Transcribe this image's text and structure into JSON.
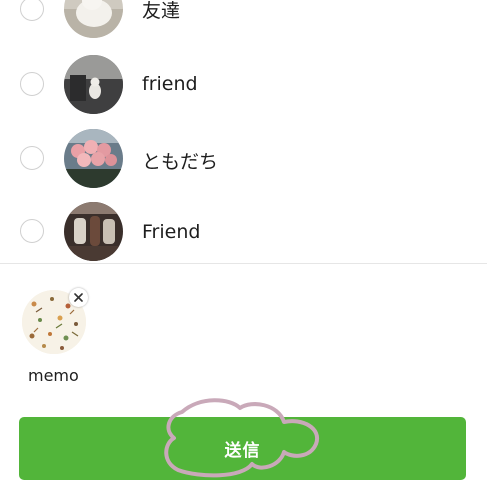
{
  "contacts": [
    {
      "name": "友達",
      "selected": false,
      "avatar_icon": "white-cat-photo"
    },
    {
      "name": "friend",
      "selected": false,
      "avatar_icon": "cat-on-sofa-photo"
    },
    {
      "name": "ともだち",
      "selected": false,
      "avatar_icon": "pink-roses-photo"
    },
    {
      "name": "Friend",
      "selected": false,
      "avatar_icon": "lanterns-photo"
    }
  ],
  "attachment": {
    "label": "memo",
    "thumb_icon": "botanical-pattern-photo",
    "remove_icon": "close-icon"
  },
  "send_button": {
    "label": "送信",
    "color": "#52b53a"
  },
  "annotation": {
    "color": "#c9a9b9",
    "icon": "hand-drawn-circle"
  }
}
